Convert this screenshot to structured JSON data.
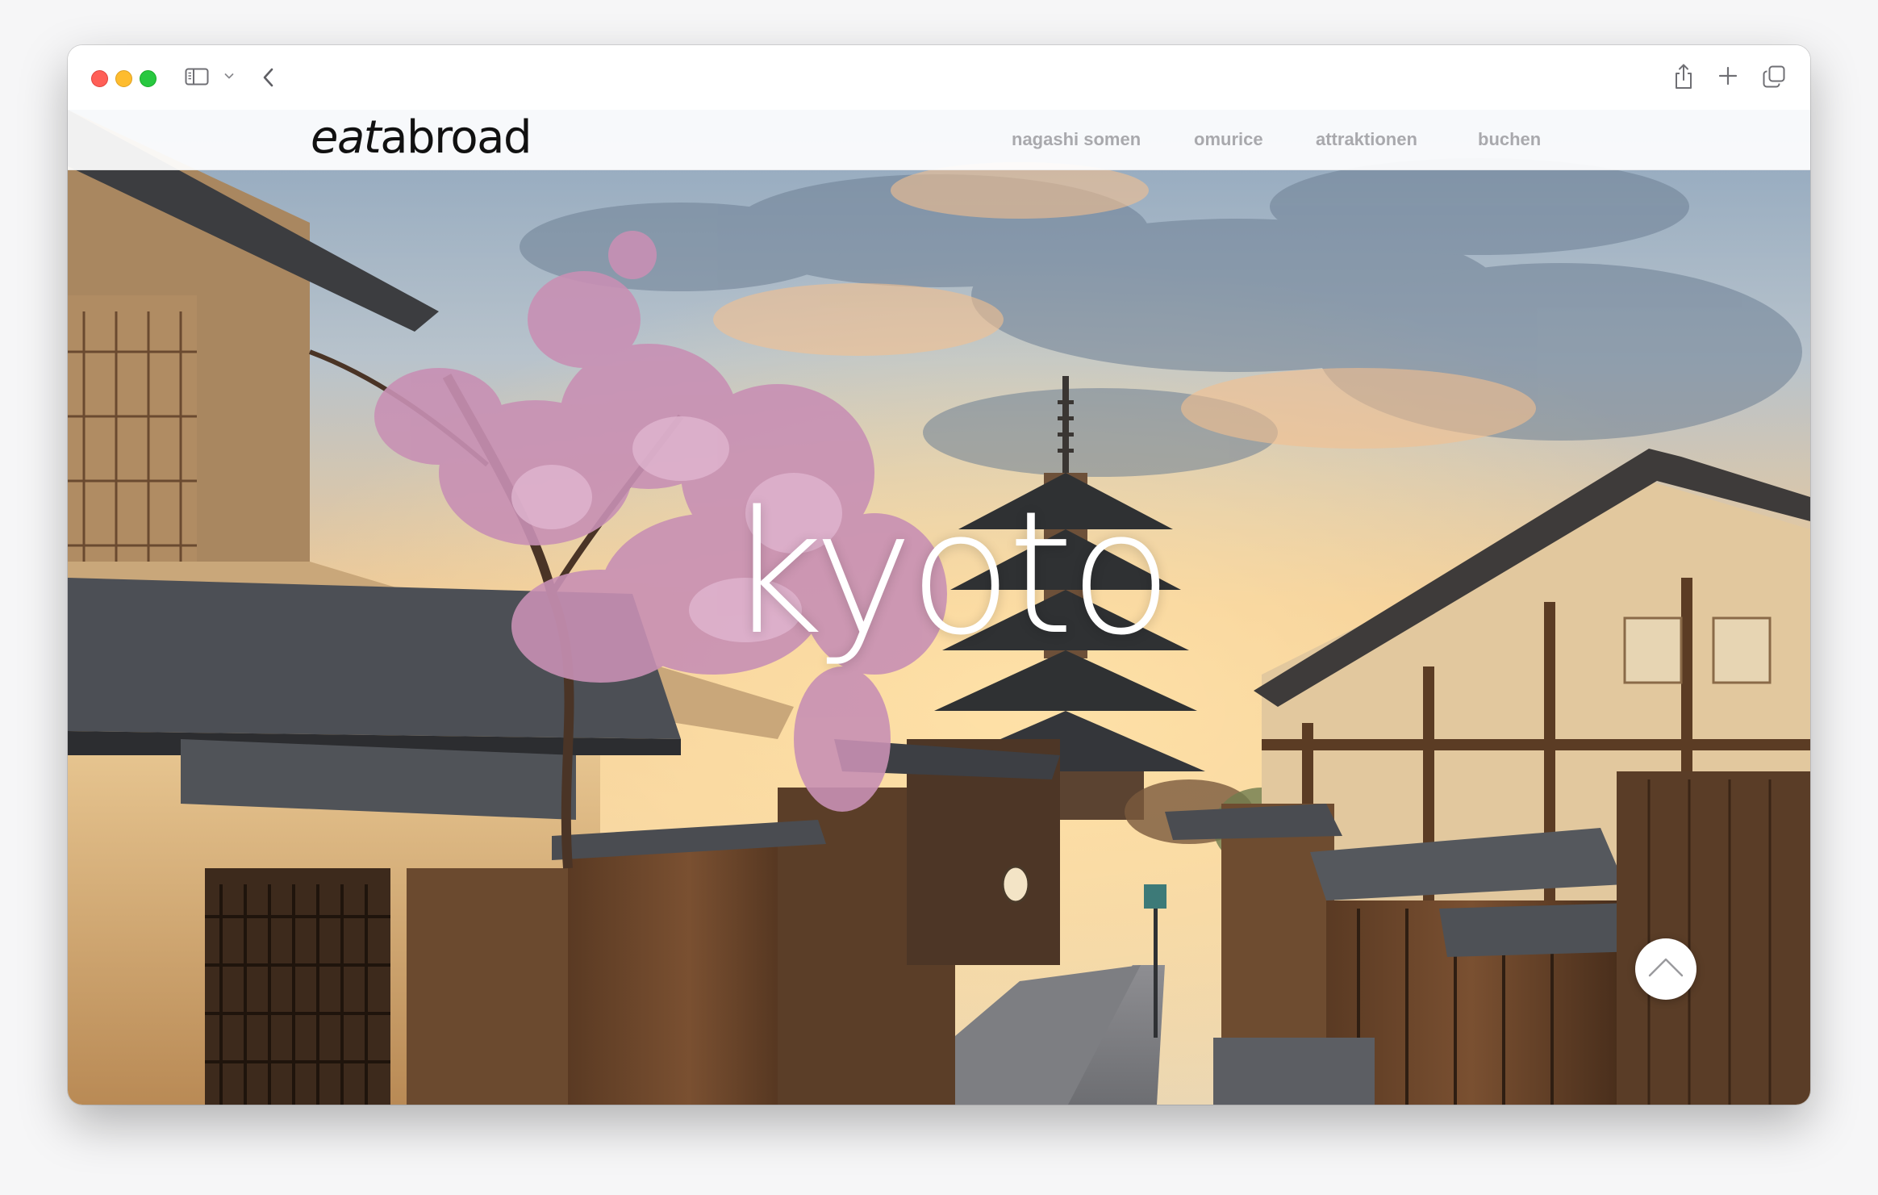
{
  "site": {
    "logo_prefix": "eat",
    "logo_suffix": "abroad",
    "nav": [
      {
        "label": "nagashi somen"
      },
      {
        "label": "omurice"
      },
      {
        "label": "attraktionen"
      },
      {
        "label": "buchen"
      }
    ]
  },
  "hero": {
    "title": "kyoto",
    "image": "kyoto-yasaka-pagoda-street-with-cherry-blossoms"
  },
  "browser": {
    "icons": [
      "close-button",
      "minimize-button",
      "maximize-button",
      "sidebar-icon",
      "chevron-down-icon",
      "back-icon",
      "share-icon",
      "plus-icon",
      "tabs-overview-icon"
    ]
  },
  "scroll_to_top": {
    "icon": "chevron-up-icon"
  },
  "colors": {
    "nav_text": "#a9a9ad",
    "logo_text": "#111111",
    "hero_text": "#ffffff",
    "close": "#ff5f57",
    "minimize": "#febc2e",
    "maximize": "#28c840"
  }
}
